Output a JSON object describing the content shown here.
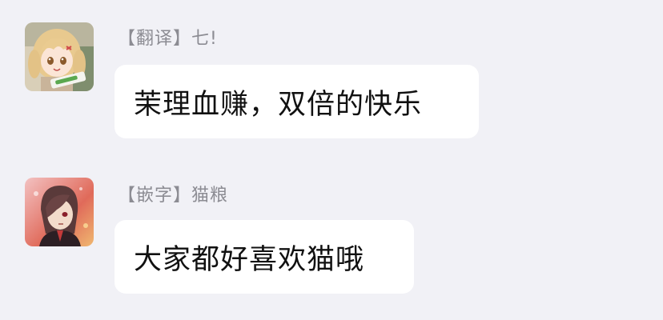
{
  "messages": [
    {
      "sender": "【翻译】七!",
      "text": "茉理血赚，双倍的快乐",
      "avatar_icon": "anime-girl-avatar"
    },
    {
      "sender": "【嵌字】猫粮",
      "text": "大家都好喜欢猫哦",
      "avatar_icon": "anime-boy-avatar"
    }
  ]
}
